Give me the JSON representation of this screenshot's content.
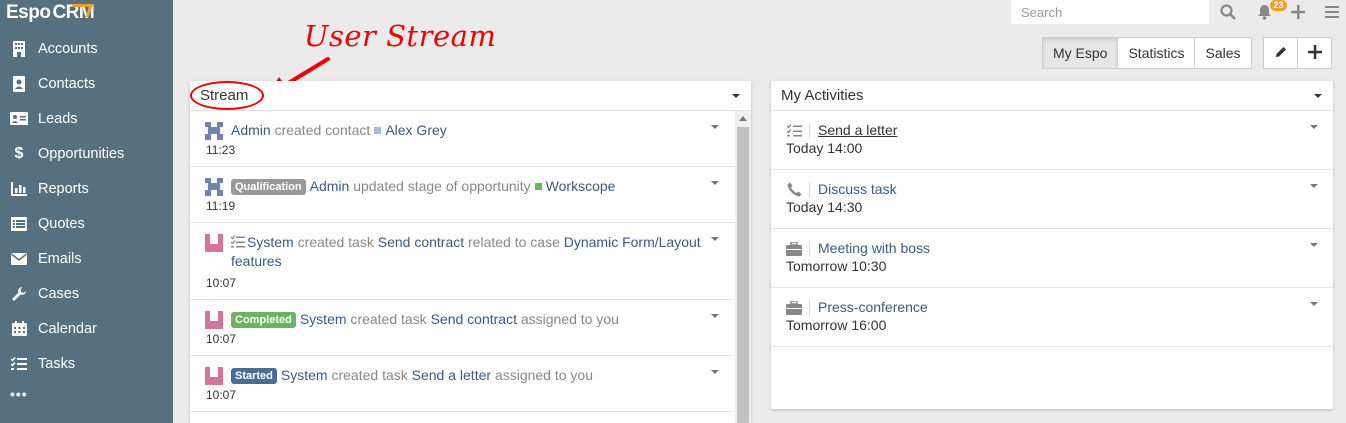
{
  "app": {
    "logo_main": "Espo",
    "logo_crm": "CRM"
  },
  "sidebar": {
    "items": [
      {
        "label": "Accounts",
        "icon": "building-icon"
      },
      {
        "label": "Contacts",
        "icon": "contact-card-icon"
      },
      {
        "label": "Leads",
        "icon": "id-card-icon"
      },
      {
        "label": "Opportunities",
        "icon": "dollar-icon"
      },
      {
        "label": "Reports",
        "icon": "bar-chart-icon"
      },
      {
        "label": "Quotes",
        "icon": "list-icon"
      },
      {
        "label": "Emails",
        "icon": "envelope-icon"
      },
      {
        "label": "Cases",
        "icon": "wrench-icon"
      },
      {
        "label": "Calendar",
        "icon": "calendar-icon"
      },
      {
        "label": "Tasks",
        "icon": "tasks-icon"
      }
    ],
    "more": "•••"
  },
  "topbar": {
    "search_placeholder": "Search",
    "notifications_count": "23"
  },
  "dashboard_tabs": [
    "My Espo",
    "Statistics",
    "Sales"
  ],
  "annotation": {
    "text": "User Stream"
  },
  "stream": {
    "title": "Stream",
    "items": [
      {
        "actor": "Admin",
        "action": " created contact",
        "target": "Alex Grey",
        "time": "11:23"
      },
      {
        "badge": "Qualification",
        "actor": "Admin",
        "action": " updated stage of opportunity",
        "target": "Workscope",
        "time": "11:19"
      },
      {
        "actor": "System",
        "action": " created task ",
        "target": "Send contract",
        "action2": " related to case ",
        "target2": "Dynamic Form/Layout features",
        "time": "10:07"
      },
      {
        "badge": "Completed",
        "actor": "System",
        "action": " created task ",
        "target": "Send contract",
        "action2": " assigned to you",
        "time": "10:07"
      },
      {
        "badge": "Started",
        "actor": "System",
        "action": " created task ",
        "target": "Send a letter",
        "action2": " assigned to you",
        "time": "10:07"
      }
    ]
  },
  "activities": {
    "title": "My Activities",
    "items": [
      {
        "icon": "tasks-icon",
        "name": "Send a letter",
        "date": "Today 14:00"
      },
      {
        "icon": "phone-icon",
        "name": "Discuss task",
        "date": "Today 14:30"
      },
      {
        "icon": "briefcase-icon",
        "name": "Meeting with boss",
        "date": "Tomorrow 10:30"
      },
      {
        "icon": "briefcase-icon",
        "name": "Press-conference",
        "date": "Tomorrow 16:00"
      }
    ]
  },
  "colors": {
    "sidebar": "#56707f",
    "link": "#3c5a80",
    "qualification": "#999999",
    "completed": "#6bb35e",
    "started": "#4a6e91",
    "annotation": "#e00000"
  }
}
